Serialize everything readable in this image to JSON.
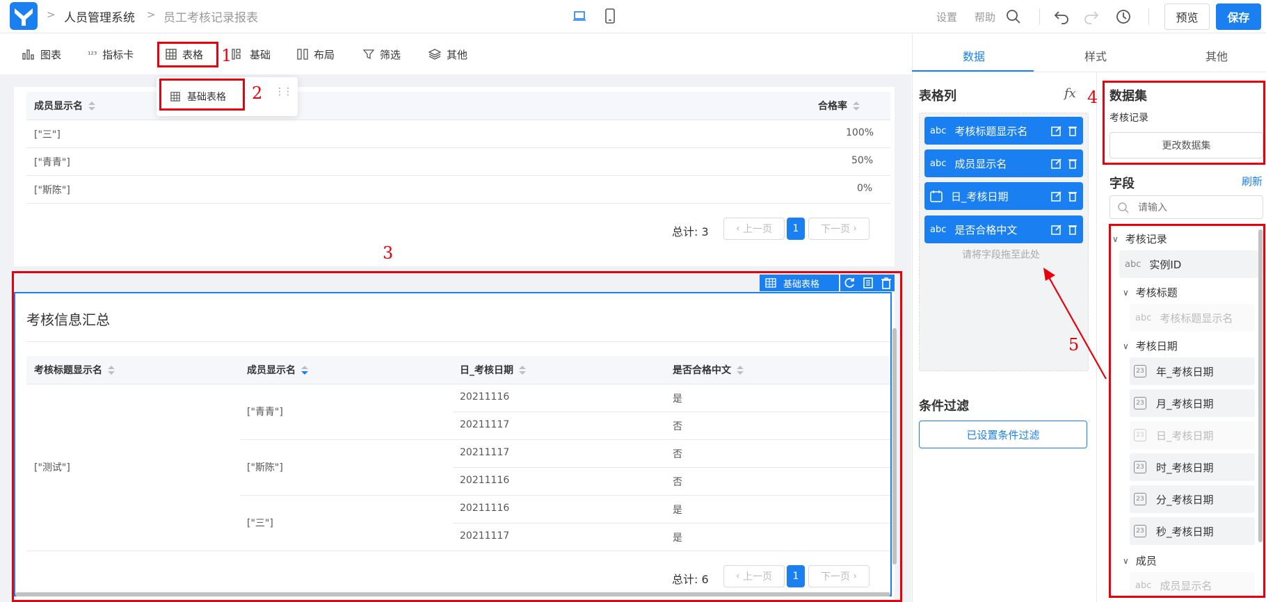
{
  "header": {
    "breadcrumb": [
      "人员管理系统",
      "员工考核记录报表"
    ],
    "settings": "设置",
    "help": "帮助",
    "preview": "预览",
    "save": "保存"
  },
  "toolbar": {
    "items": [
      "图表",
      "指标卡",
      "表格",
      "基础",
      "布局",
      "筛选",
      "其他"
    ],
    "dropdown_item": "基础表格"
  },
  "annotations": [
    "1",
    "2",
    "3",
    "4",
    "5"
  ],
  "table1": {
    "headers": [
      "成员显示名",
      "合格率"
    ],
    "rows": [
      [
        "[\"三\"]",
        "100%"
      ],
      [
        "[\"青青\"]",
        "50%"
      ],
      [
        "[\"斯陈\"]",
        "0%"
      ]
    ],
    "total": "总计: 3",
    "prev": "上一页",
    "page": "1",
    "next": "下一页"
  },
  "table2": {
    "badge": "基础表格",
    "title": "考核信息汇总",
    "headers": [
      "考核标题显示名",
      "成员显示名",
      "日_考核日期",
      "是否合格中文"
    ],
    "group": "[\"测试\"]",
    "members": [
      "[\"青青\"]",
      "[\"斯陈\"]",
      "[\"三\"]"
    ],
    "dates": [
      "20211116",
      "20211117",
      "20211117",
      "20211116",
      "20211116",
      "20211117"
    ],
    "passes": [
      "是",
      "否",
      "否",
      "否",
      "是",
      "是"
    ],
    "total": "总计: 6",
    "prev": "上一页",
    "page": "1",
    "next": "下一页"
  },
  "right_panel": {
    "tabs": [
      "数据",
      "样式",
      "其他"
    ],
    "columns_title": "表格列",
    "fx": "fx",
    "chips": [
      "考核标题显示名",
      "成员显示名",
      "日_考核日期",
      "是否合格中文"
    ],
    "chip_type_abc": "abc",
    "drop_hint": "请将字段拖至此处",
    "filter_title": "条件过滤",
    "filter_button": "已设置条件过滤",
    "dataset_title": "数据集",
    "dataset_name": "考核记录",
    "change_dataset": "更改数据集",
    "fields_title": "字段",
    "refresh": "刷新",
    "search_placeholder": "请输入",
    "tree": {
      "root": "考核记录",
      "instance_id": "实例ID",
      "group_title": "考核标题",
      "title_display": "考核标题显示名",
      "group_date": "考核日期",
      "dates": [
        "年_考核日期",
        "月_考核日期",
        "日_考核日期",
        "时_考核日期",
        "分_考核日期",
        "秒_考核日期"
      ],
      "group_member": "成员",
      "member_display": "成员显示名"
    }
  },
  "colors": {
    "primary": "#1a7ff0",
    "annotation_red": "#e8000b"
  }
}
